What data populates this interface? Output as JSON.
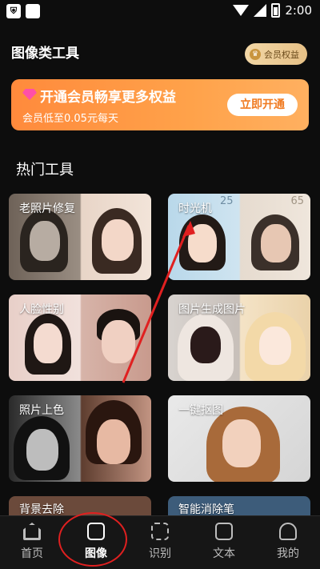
{
  "status_bar": {
    "time": "2:00",
    "left_icons": [
      "shield-icon",
      "square-icon"
    ]
  },
  "header": {
    "title": "图像类工具",
    "vip_label": "会员权益"
  },
  "banner": {
    "title": "开通会员畅享更多权益",
    "subtitle": "会员低至0.05元每天",
    "button": "立即开通"
  },
  "section": {
    "title": "热门工具"
  },
  "tools": [
    {
      "label": "老照片修复"
    },
    {
      "label": "时光机",
      "age_a": "25",
      "age_b": "65"
    },
    {
      "label": "人脸性别"
    },
    {
      "label": "图片生成图片"
    },
    {
      "label": "照片上色"
    },
    {
      "label": "一键抠图"
    },
    {
      "label": "背景去除"
    },
    {
      "label": "智能消除笔"
    }
  ],
  "tabs": [
    {
      "label": "首页",
      "icon": "home-icon"
    },
    {
      "label": "图像",
      "icon": "image-icon",
      "active": true
    },
    {
      "label": "识别",
      "icon": "scan-icon"
    },
    {
      "label": "文本",
      "icon": "text-icon"
    },
    {
      "label": "我的",
      "icon": "person-icon"
    }
  ],
  "colors": {
    "accent_orange": "#ff8a3c",
    "highlight_red": "#e02020"
  }
}
